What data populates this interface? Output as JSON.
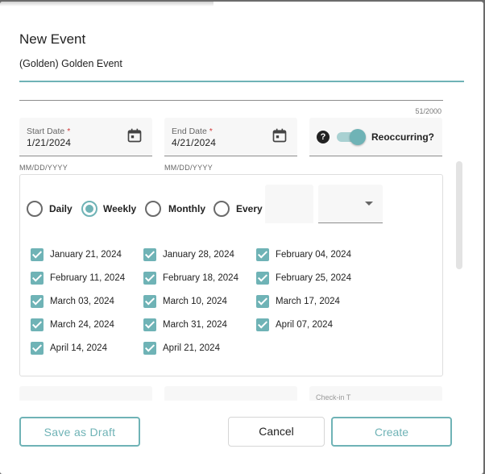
{
  "dialog": {
    "title": "New Event",
    "event_name": "(Golden) Golden Event",
    "description_counter": "51/2000"
  },
  "start_date": {
    "label": "Start Date",
    "required_mark": "*",
    "value": "1/21/2024",
    "hint": "MM/DD/YYYY",
    "icon": "calendar-icon"
  },
  "end_date": {
    "label": "End Date",
    "required_mark": "*",
    "value": "4/21/2024",
    "hint": "MM/DD/YYYY",
    "icon": "calendar-icon"
  },
  "reoccurring": {
    "help_icon": "?",
    "label": "Reoccurring?",
    "enabled": true
  },
  "frequency": {
    "options": [
      "Daily",
      "Weekly",
      "Monthly",
      "Every"
    ],
    "selected": "Weekly"
  },
  "occurrences": [
    "January 21, 2024",
    "January 28, 2024",
    "February 04, 2024",
    "February 11, 2024",
    "February 18, 2024",
    "February 25, 2024",
    "March 03, 2024",
    "March 10, 2024",
    "March 17, 2024",
    "March 24, 2024",
    "March 31, 2024",
    "April 07, 2024",
    "April 14, 2024",
    "April 21, 2024"
  ],
  "footer": {
    "ghost_label": "Check-in T",
    "save_draft": "Save as Draft",
    "cancel": "Cancel",
    "create": "Create"
  },
  "colors": {
    "accent": "#6fb3b6",
    "required": "#d23b3b"
  }
}
